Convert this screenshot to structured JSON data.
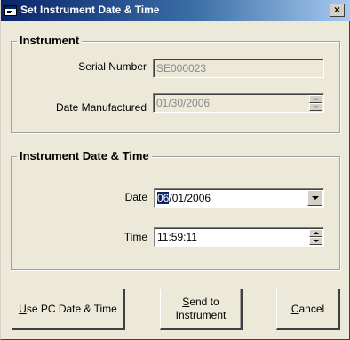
{
  "window": {
    "title": "Set Instrument Date & Time",
    "close_glyph": "×"
  },
  "instrument_group": {
    "title": "Instrument",
    "serial_label": "Serial Number",
    "serial_value": "SE000023",
    "date_manufactured_label": "Date Manufactured",
    "date_manufactured_value": "01/30/2006"
  },
  "datetime_group": {
    "title": "Instrument Date & Time",
    "date_label": "Date",
    "date_month_selected": "06",
    "date_rest": "/01/2006",
    "time_label": "Time",
    "time_value": "11:59:11"
  },
  "buttons": {
    "use_pc": {
      "mnemonic": "U",
      "rest": "se PC Date & Time"
    },
    "send": {
      "line1_mnemonic": "S",
      "line1_rest": "end to",
      "line2": "Instrument"
    },
    "cancel": {
      "mnemonic": "C",
      "rest": "ancel"
    }
  },
  "icons": {
    "app": "window-app-icon",
    "close": "close-icon",
    "spin_up": "spin-up-arrow-icon",
    "spin_down": "spin-down-arrow-icon",
    "dropdown": "dropdown-arrow-icon"
  }
}
